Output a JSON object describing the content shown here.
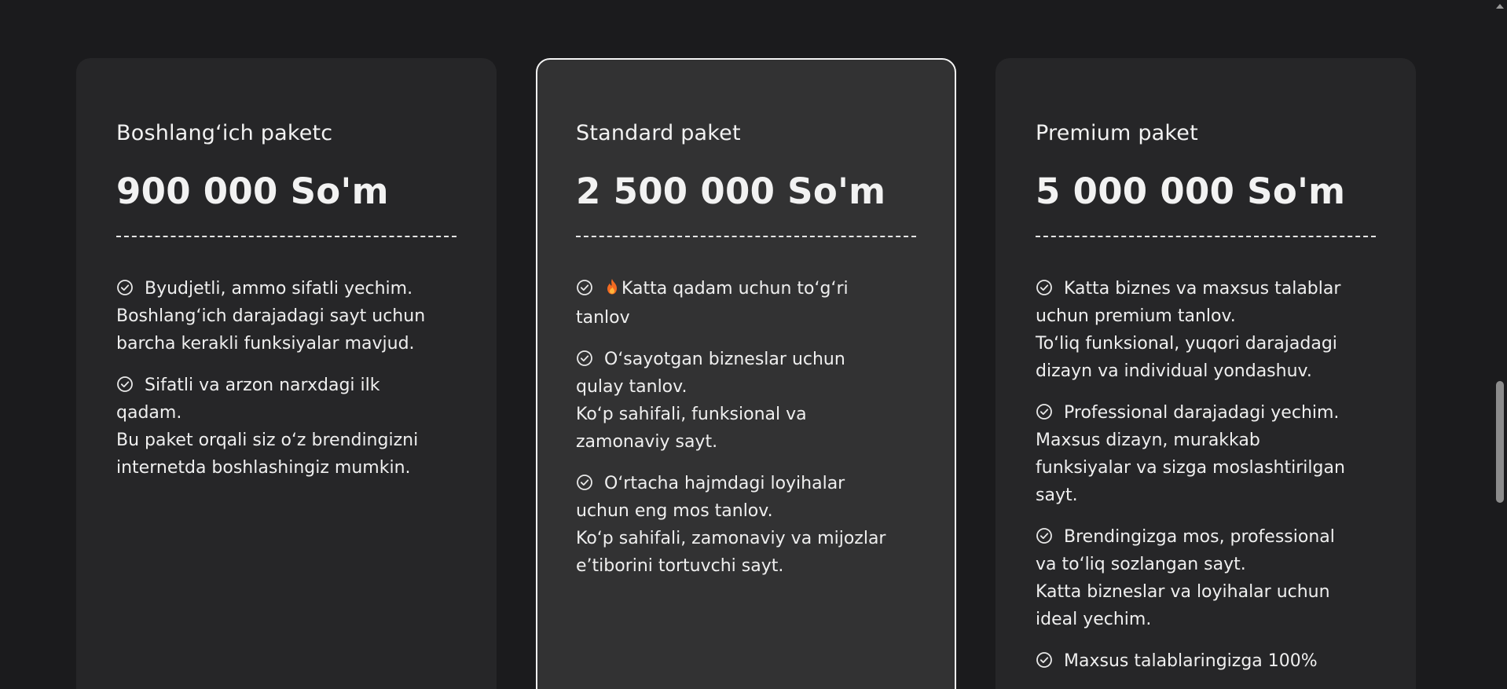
{
  "icons": {
    "check": "check-circle-icon",
    "fire": "fire-icon"
  },
  "colors": {
    "background": "#1b1b1d",
    "card": "#262628",
    "card_featured": "#323233",
    "featured_border": "#f5f5f5",
    "text": "#f2f2f2"
  },
  "cards": [
    {
      "title": "Boshlang‘ich paketc",
      "price": "900 000 So'm",
      "features": [
        {
          "first": "Byudjetli, ammo sifatli yechim.",
          "rest": [
            "Boshlang‘ich darajadagi sayt uchun",
            "barcha kerakli funksiyalar mavjud."
          ]
        },
        {
          "first": "Sifatli va arzon narxdagi ilk",
          "rest": [
            "qadam.",
            "Bu paket orqali siz o‘z brendingizni",
            "internetda boshlashingiz mumkin."
          ]
        }
      ]
    },
    {
      "title": "Standard paket",
      "price": "2 500 000 So'm",
      "features": [
        {
          "first": "Katta qadam uchun to‘g‘ri",
          "rest": [
            "tanlov"
          ]
        },
        {
          "first": "O‘sayotgan bizneslar uchun",
          "rest": [
            "qulay tanlov.",
            "Ko‘p sahifali, funksional va",
            "zamonaviy sayt."
          ]
        },
        {
          "first": "O‘rtacha hajmdagi loyihalar",
          "rest": [
            "uchun eng mos tanlov.",
            "Ko‘p sahifali, zamonaviy va mijozlar",
            "e’tiborini tortuvchi sayt."
          ]
        }
      ]
    },
    {
      "title": "Premium paket",
      "price": "5 000 000 So'm",
      "features": [
        {
          "first": "Katta biznes va maxsus talablar",
          "rest": [
            "uchun premium tanlov.",
            "To‘liq funksional, yuqori darajadagi",
            "dizayn va individual yondashuv."
          ]
        },
        {
          "first": "Professional darajadagi yechim.",
          "rest": [
            "Maxsus dizayn, murakkab",
            "funksiyalar va sizga moslashtirilgan",
            "sayt."
          ]
        },
        {
          "first": "Brendingizga mos, professional",
          "rest": [
            "va to‘liq sozlangan sayt.",
            "Katta bizneslar va loyihalar uchun",
            "ideal yechim."
          ]
        },
        {
          "first": "Maxsus talablaringizga 100%",
          "rest": []
        }
      ]
    }
  ]
}
